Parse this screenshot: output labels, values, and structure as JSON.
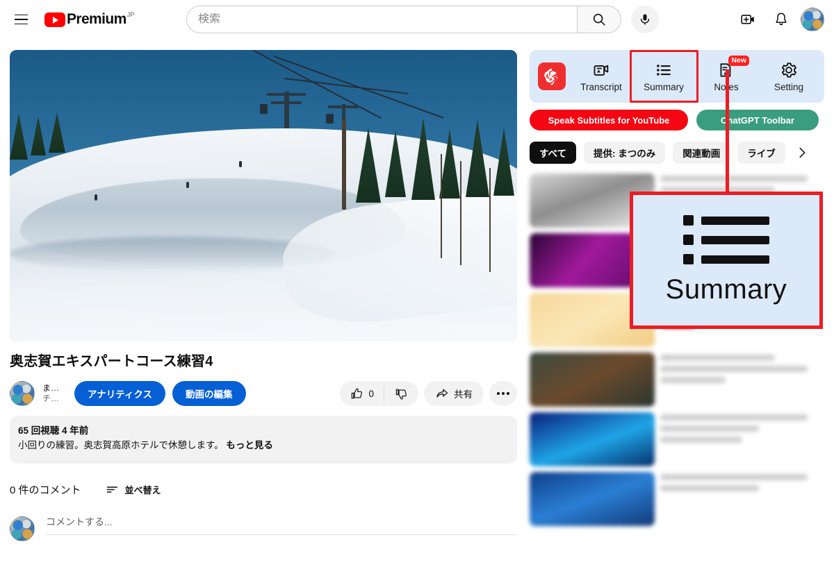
{
  "topbar": {
    "menu_icon": "hamburger-icon",
    "logo_text": "Premium",
    "logo_sup": "JP",
    "search_placeholder": "検索",
    "search_value": "",
    "search_icon": "search-icon",
    "mic_icon": "microphone-icon",
    "create_icon": "create-video-icon",
    "notifications_icon": "bell-icon",
    "avatar": "account-avatar"
  },
  "video": {
    "title": "奥志賀エキスパートコース練習4",
    "channel_name_line1": "ま…",
    "channel_name_line2": "チ…",
    "analytics_label": "アナリティクス",
    "edit_label": "動画の編集",
    "like_count": "0",
    "like_icon": "thumbs-up-icon",
    "dislike_icon": "thumbs-down-icon",
    "share_label": "共有",
    "share_icon": "share-arrow-icon",
    "more_icon": "more-options-icon",
    "views_and_date": "65 回視聴  4 年前",
    "description": "小回りの練習。奥志賀高原ホテルで休憩します。",
    "show_more": "もっと見る"
  },
  "comments": {
    "count_label": "0 件のコメント",
    "sort_label": "並べ替え",
    "sort_icon": "sort-icon",
    "input_placeholder": "コメントする...",
    "input_value": ""
  },
  "extension": {
    "buttons": [
      {
        "label": "Transcript",
        "icon": "transcript-icon",
        "badge": ""
      },
      {
        "label": "Summary",
        "icon": "list-summary-icon",
        "badge": ""
      },
      {
        "label": "Notes",
        "icon": "notes-pencil-icon",
        "badge": "New"
      },
      {
        "label": "Setting",
        "icon": "gear-icon",
        "badge": ""
      }
    ],
    "logo_icon": "chatgpt-logo-icon",
    "speak_subtitles_label": "Speak Subtitles for YouTube",
    "chatgpt_toolbar_label": "ChatGPT Toolbar",
    "panel_bg": "#dce9f9",
    "speak_btn_color": "#f40612",
    "toolbar_btn_color": "#3a9e7e",
    "badge_color": "#ff2020"
  },
  "chips": [
    {
      "label": "すべて",
      "active": true
    },
    {
      "label": "提供: まつのみ",
      "active": false
    },
    {
      "label": "関連動画",
      "active": false
    },
    {
      "label": "ライブ",
      "active": false
    }
  ],
  "chips_next_icon": "chevron-right-icon",
  "annotation": {
    "zoom_label": "Summary",
    "zoom_icon": "list-summary-icon",
    "highlight_color": "#ed1c24",
    "zoom_bg": "#dce9f9"
  }
}
